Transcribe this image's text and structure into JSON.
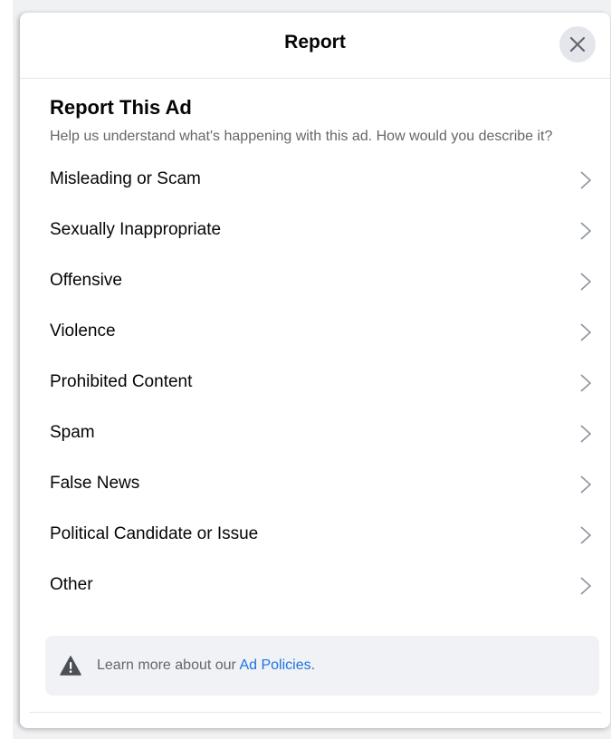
{
  "header": {
    "title": "Report",
    "close_icon": "close-icon"
  },
  "main": {
    "heading": "Report This Ad",
    "subtitle": "Help us understand what's happening with this ad. How would you describe it?",
    "options": [
      {
        "label": "Misleading or Scam",
        "icon": "chevron-right-icon"
      },
      {
        "label": "Sexually Inappropriate",
        "icon": "chevron-right-icon"
      },
      {
        "label": "Offensive",
        "icon": "chevron-right-icon"
      },
      {
        "label": "Violence",
        "icon": "chevron-right-icon"
      },
      {
        "label": "Prohibited Content",
        "icon": "chevron-right-icon"
      },
      {
        "label": "Spam",
        "icon": "chevron-right-icon"
      },
      {
        "label": "False News",
        "icon": "chevron-right-icon"
      },
      {
        "label": "Political Candidate or Issue",
        "icon": "chevron-right-icon"
      },
      {
        "label": "Other",
        "icon": "chevron-right-icon"
      }
    ]
  },
  "info": {
    "icon": "warning-icon",
    "text": "Learn more about our ",
    "link": "Ad Policies",
    "suffix": "."
  },
  "colors": {
    "link": "#1b74e4",
    "secondary_text": "#65676b",
    "primary_text": "#050505",
    "info_background": "#f0f2f5"
  }
}
